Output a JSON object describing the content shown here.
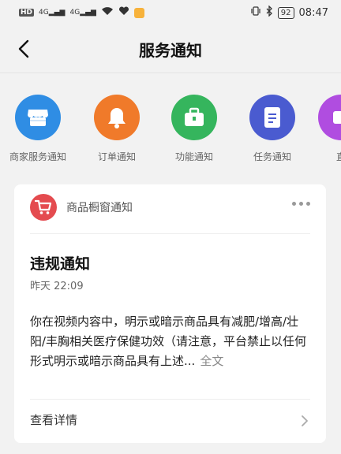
{
  "status_bar": {
    "network_label": "HD",
    "network_gen_1": "4G",
    "network_gen_2": "4G",
    "battery": "92",
    "time": "08:47"
  },
  "header": {
    "title": "服务通知"
  },
  "categories": [
    {
      "label": "商家服务通知",
      "color": "#2f8de4",
      "icon": "store-icon"
    },
    {
      "label": "订单通知",
      "color": "#f07a2a",
      "icon": "bell-icon"
    },
    {
      "label": "功能通知",
      "color": "#35b55d",
      "icon": "briefcase-icon"
    },
    {
      "label": "任务通知",
      "color": "#4a5bd0",
      "icon": "document-icon"
    },
    {
      "label": "直",
      "color": "#b04de0",
      "icon": "live-icon"
    }
  ],
  "notification": {
    "source": "商品橱窗通知",
    "source_icon": "cart-icon",
    "title": "违规通知",
    "time": "昨天 22:09",
    "body": "你在视频内容中，明示或暗示商品具有减肥/增高/壮阳/丰胸相关医疗保健功效（请注意，平台禁止以任何形式明示或暗示商品具有上述...",
    "expand_label": "全文",
    "detail_label": "查看详情"
  }
}
